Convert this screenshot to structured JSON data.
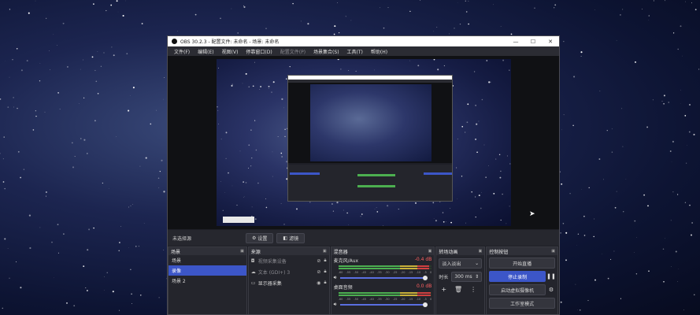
{
  "window": {
    "title": "OBS 30.2.3 - 配置文件: 未命名 - 场景: 未命名",
    "minimize": "—",
    "maximize": "☐",
    "close": "✕"
  },
  "menu": [
    {
      "label": "文件(F)",
      "enabled": true
    },
    {
      "label": "编辑(E)",
      "enabled": true
    },
    {
      "label": "视图(V)",
      "enabled": true
    },
    {
      "label": "停靠窗口(D)",
      "enabled": true
    },
    {
      "label": "配置文件(P)",
      "enabled": false
    },
    {
      "label": "场景集合(S)",
      "enabled": true
    },
    {
      "label": "工具(T)",
      "enabled": true
    },
    {
      "label": "帮助(H)",
      "enabled": true
    }
  ],
  "context_bar": {
    "no_source": "未选择源",
    "properties": "设置",
    "filters": "滤镜"
  },
  "scenes": {
    "title": "场景",
    "items": [
      {
        "label": "场景",
        "selected": false
      },
      {
        "label": "录像",
        "selected": true
      },
      {
        "label": "场景 2",
        "selected": false
      }
    ]
  },
  "sources": {
    "title": "来源",
    "items": [
      {
        "icon": "camera-icon",
        "glyph": "◘",
        "label": "视频采集设备",
        "visible": false
      },
      {
        "icon": "text-icon",
        "glyph": "☁",
        "label": "文本 (GDI+) 3",
        "visible": false
      },
      {
        "icon": "monitor-icon",
        "glyph": "▭",
        "label": "显示器采集",
        "visible": true
      }
    ]
  },
  "mixer": {
    "title": "混音器",
    "channels": [
      {
        "name": "麦克风/Aux",
        "db": "-0.4 dB",
        "level": 0.97
      },
      {
        "name": "桌面音频",
        "db": "0.0 dB",
        "level": 0.99
      }
    ],
    "scale": [
      "-60",
      "-55",
      "-50",
      "-45",
      "-40",
      "-35",
      "-30",
      "-25",
      "-20",
      "-15",
      "-10",
      "-5",
      "0"
    ]
  },
  "transitions": {
    "title": "转场动画",
    "selected": "淡入淡出",
    "duration_label": "时长",
    "duration": "300 ms"
  },
  "controls": {
    "title": "控制按钮",
    "start_stream": "开始直播",
    "stop_recording": "停止录制",
    "virtual_camera": "启动虚拟摄像机",
    "studio_mode": "工作室模式"
  },
  "colors": {
    "accent": "#3c56c8",
    "meter_green": "#4caf50",
    "meter_yellow": "#c9b03a",
    "meter_red": "#d04040"
  }
}
